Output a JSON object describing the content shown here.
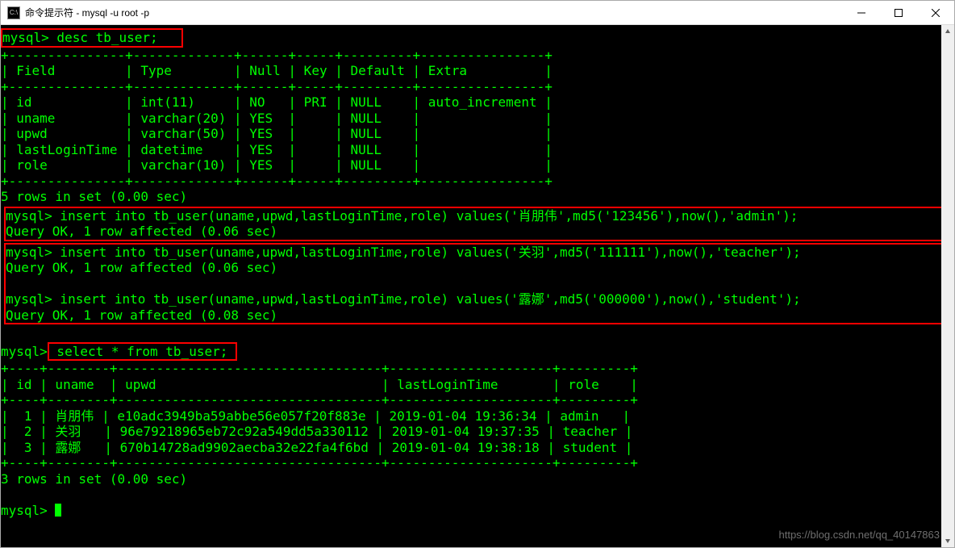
{
  "titlebar": {
    "icon_text": "C:\\",
    "title": "命令提示符 - mysql  -u root -p"
  },
  "prompt": "mysql>",
  "cmd_desc": " desc tb_user;",
  "desc_table": {
    "border_top": "+---------------+-------------+------+-----+---------+----------------+",
    "header": "| Field         | Type        | Null | Key | Default | Extra          |",
    "border_mid": "+---------------+-------------+------+-----+---------+----------------+",
    "r1": "| id            | int(11)     | NO   | PRI | NULL    | auto_increment |",
    "r2": "| uname         | varchar(20) | YES  |     | NULL    |                |",
    "r3": "| upwd          | varchar(50) | YES  |     | NULL    |                |",
    "r4": "| lastLoginTime | datetime    | YES  |     | NULL    |                |",
    "r5": "| role          | varchar(10) | YES  |     | NULL    |                |",
    "border_bot": "+---------------+-------------+------+-----+---------+----------------+",
    "summary": "5 rows in set (0.00 sec)"
  },
  "inserts": {
    "i1_cmd": "mysql> insert into tb_user(uname,upwd,lastLoginTime,role) values('肖朋伟',md5('123456'),now(),'admin');",
    "i1_res": "Query OK, 1 row affected (0.06 sec)",
    "i2_cmd": "mysql> insert into tb_user(uname,upwd,lastLoginTime,role) values('关羽',md5('111111'),now(),'teacher');",
    "i2_res": "Query OK, 1 row affected (0.06 sec)",
    "i3_cmd": "mysql> insert into tb_user(uname,upwd,lastLoginTime,role) values('露娜',md5('000000'),now(),'student');",
    "i3_res": "Query OK, 1 row affected (0.08 sec)"
  },
  "cmd_select": " select * from tb_user;",
  "select_table": {
    "border_top": "+----+--------+----------------------------------+---------------------+---------+",
    "header": "| id | uname  | upwd                             | lastLoginTime       | role    |",
    "border_mid": "+----+--------+----------------------------------+---------------------+---------+",
    "r1": "|  1 | 肖朋伟 | e10adc3949ba59abbe56e057f20f883e | 2019-01-04 19:36:34 | admin   |",
    "r2": "|  2 | 关羽   | 96e79218965eb72c92a549dd5a330112 | 2019-01-04 19:37:35 | teacher |",
    "r3": "|  3 | 露娜   | 670b14728ad9902aecba32e22fa4f6bd | 2019-01-04 19:38:18 | student |",
    "border_bot": "+----+--------+----------------------------------+---------------------+---------+",
    "summary": "3 rows in set (0.00 sec)"
  },
  "watermark": "https://blog.csdn.net/qq_40147863"
}
